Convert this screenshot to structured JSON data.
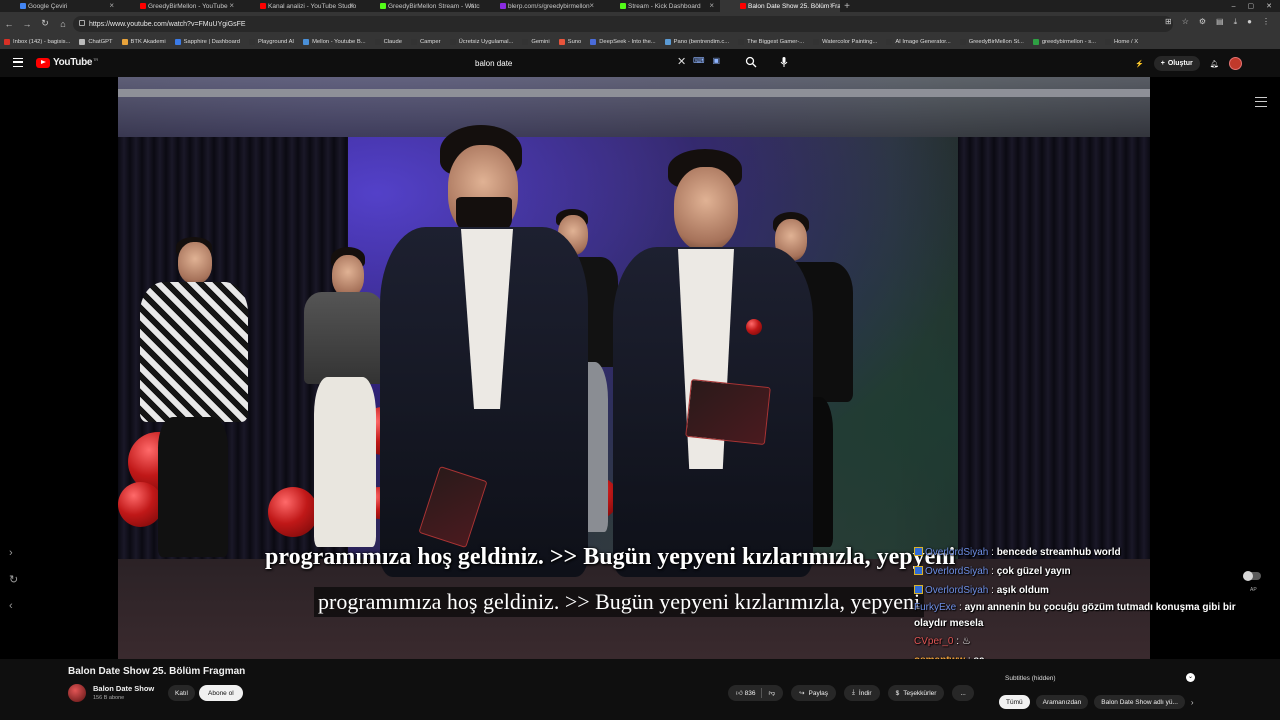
{
  "browser": {
    "tabs": [
      {
        "label": "Google Çeviri",
        "color": "#4285f4"
      },
      {
        "label": "GreedyBirMellon - YouTube",
        "color": "#ff0000"
      },
      {
        "label": "Kanal analizi - YouTube Studio",
        "color": "#ff0000"
      },
      {
        "label": "GreedyBirMellon Stream - Watch...",
        "color": "#53fc18"
      },
      {
        "label": "blerp.com/s/greedybirmellon",
        "color": "#8a2be2"
      },
      {
        "label": "Stream - Kick Dashboard",
        "color": "#53fc18"
      },
      {
        "label": "Balon Date Show 25. Bölüm Frag...",
        "color": "#ff0000"
      }
    ],
    "url": "https://www.youtube.com/watch?v=FMuUYgiGsFE",
    "bookmarks": [
      {
        "label": "Inbox (142) - bagisis...",
        "color": "#d93025"
      },
      {
        "label": "ChatGPT",
        "color": "#bbbbbb"
      },
      {
        "label": "BTK Akademi",
        "color": "#e8a33b"
      },
      {
        "label": "Sapphire | Dashboard",
        "color": "#3b7be8"
      },
      {
        "label": "Playground AI",
        "color": "#333333"
      },
      {
        "label": "Mellon - Youtube B...",
        "color": "#4a90d9"
      },
      {
        "label": "Claude",
        "color": "#333333"
      },
      {
        "label": "Camper",
        "color": "#333333"
      },
      {
        "label": "Ücretsiz Uygulamal...",
        "color": "#333333"
      },
      {
        "label": "Gemini",
        "color": "#333333"
      },
      {
        "label": "Suno",
        "color": "#e8543b"
      },
      {
        "label": "DeepSeek - Into the...",
        "color": "#4a6bd9"
      },
      {
        "label": "Pano (bentrendim.c...",
        "color": "#5b9bd5"
      },
      {
        "label": "The Biggest Gamer-...",
        "color": "#333333"
      },
      {
        "label": "Watercolor Painting...",
        "color": "#333333"
      },
      {
        "label": "AI Image Generator...",
        "color": "#333333"
      },
      {
        "label": "GreedyBirMellon St...",
        "color": "#333333"
      },
      {
        "label": "greedybirmellon - s...",
        "color": "#2ea043"
      },
      {
        "label": "Home / X",
        "color": "#333333"
      }
    ]
  },
  "youtube": {
    "logo": "YouTube",
    "region": "TR",
    "search_value": "balon date",
    "create_label": "Oluştur"
  },
  "subtitles": {
    "top": "programımıza hoş geldiniz. >> Bugün yepyeni kızlarımızla, yepyeni",
    "bottom": "programımıza hoş geldiniz. >> Bugün yepyeni kızlarımızla, yepyeni"
  },
  "chat": [
    {
      "user": "OverlordSiyah",
      "msg": "bencede streamhub world"
    },
    {
      "user": "OverlordSiyah",
      "msg": "çok güzel yayın"
    },
    {
      "user": "OverlordSiyah",
      "msg": "aşık oldum"
    },
    {
      "user": "FurkyExe",
      "msg": "aynı annenin bu çocuğu gözüm tutmadı konuşma gibi bir olaydır mesela"
    },
    {
      "user": "CVper_0",
      "msg": ""
    },
    {
      "user": "osmantww",
      "msg": "sa"
    }
  ],
  "video": {
    "title": "Balon Date Show 25. Bölüm Fragman",
    "channel": "Balon Date Show",
    "subs": "156 B abone",
    "join_label": "Katıl",
    "subscribe_label": "Abone ol",
    "likes": "836",
    "share_label": "Paylaş",
    "download_label": "İndir",
    "thanks_label": "Teşekkürler",
    "more_label": "..."
  },
  "side_panel": {
    "subtitles_label": "Subtitles (hidden)",
    "chips": [
      "Tümü",
      "Aramanızdan",
      "Balon Date Show adlı yü..."
    ]
  },
  "player": {
    "ap_label": "AP"
  }
}
